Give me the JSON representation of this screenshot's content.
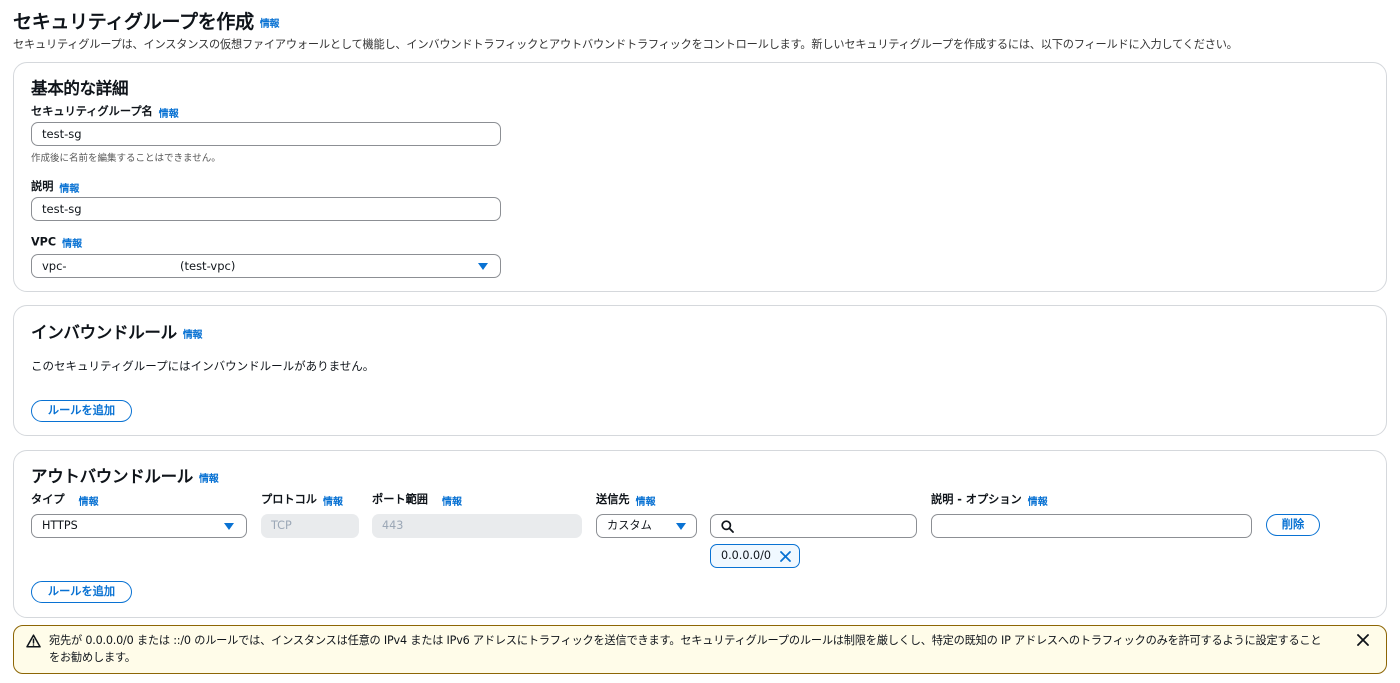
{
  "header": {
    "title": "セキュリティグループを作成",
    "info": "情報",
    "description": "セキュリティグループは、インスタンスの仮想ファイアウォールとして機能し、インバウンドトラフィックとアウトバウンドトラフィックをコントロールします。新しいセキュリティグループを作成するには、以下のフィールドに入力してください。"
  },
  "basic": {
    "title": "基本的な詳細",
    "name_label": "セキュリティグループ名",
    "name_info": "情報",
    "name_value": "test-sg",
    "name_hint": "作成後に名前を編集することはできません。",
    "desc_label": "説明",
    "desc_info": "情報",
    "desc_value": "test-sg",
    "vpc_label": "VPC",
    "vpc_info": "情報",
    "vpc_prefix": "vpc-",
    "vpc_name": "(test-vpc)"
  },
  "inbound": {
    "title": "インバウンドルール",
    "info": "情報",
    "empty": "このセキュリティグループにはインバウンドルールがありません。",
    "add_button": "ルールを追加"
  },
  "outbound": {
    "title": "アウトバウンドルール",
    "info": "情報",
    "columns": {
      "type": "タイプ",
      "protocol": "プロトコル",
      "port": "ポート範囲",
      "dest": "送信先",
      "desc": "説明 - オプション",
      "info": "情報"
    },
    "row": {
      "type": "HTTPS",
      "protocol": "TCP",
      "port": "443",
      "dest": "カスタム",
      "search_value": "",
      "desc_value": "",
      "delete_button": "削除",
      "token": "0.0.0.0/0"
    },
    "add_button": "ルールを追加"
  },
  "warning": {
    "text": "宛先が 0.0.0.0/0 または ::/0 のルールでは、インスタンスは任意の IPv4 または IPv6 アドレスにトラフィックを送信できます。セキュリティグループのルールは制限を厳しくし、特定の既知の IP アドレスへのトラフィックのみを許可するように設定することをお勧めします。"
  },
  "colors": {
    "accent": "#0972d3",
    "warning_border": "#8d6605",
    "warning_bg": "#fffce9"
  }
}
